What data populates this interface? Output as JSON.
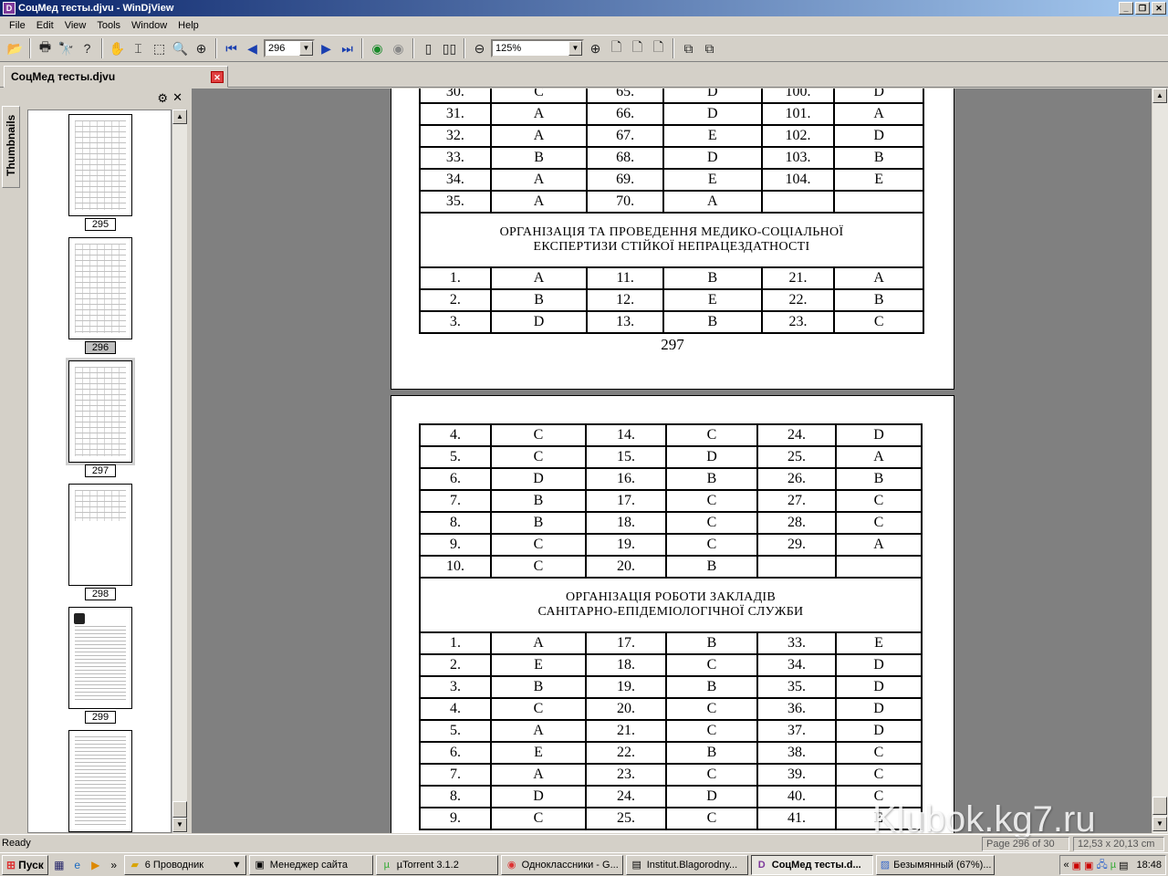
{
  "window": {
    "title": "СоцМед тесты.djvu - WinDjView"
  },
  "menu": [
    "File",
    "Edit",
    "View",
    "Tools",
    "Window",
    "Help"
  ],
  "toolbar": {
    "page_value": "296",
    "zoom_value": "125%"
  },
  "doc_tab": {
    "label": "СоцМед тесты.djvu"
  },
  "sidebar": {
    "tab_label": "Thumbnails",
    "thumbs": [
      {
        "label": "295"
      },
      {
        "label": "296"
      },
      {
        "label": "297"
      },
      {
        "label": "298"
      },
      {
        "label": "299"
      }
    ]
  },
  "page297": {
    "rows_top": [
      [
        "30.",
        "C",
        "65.",
        "D",
        "100.",
        "D"
      ],
      [
        "31.",
        "A",
        "66.",
        "D",
        "101.",
        "A"
      ],
      [
        "32.",
        "A",
        "67.",
        "E",
        "102.",
        "D"
      ],
      [
        "33.",
        "B",
        "68.",
        "D",
        "103.",
        "B"
      ],
      [
        "34.",
        "A",
        "69.",
        "E",
        "104.",
        "E"
      ],
      [
        "35.",
        "A",
        "70.",
        "A",
        "",
        ""
      ]
    ],
    "section_title": "ОРГАНІЗАЦІЯ ТА ПРОВЕДЕННЯ МЕДИКО-СОЦІАЛЬНОЇ ЕКСПЕРТИЗИ СТІЙКОЇ НЕПРАЦЕЗДАТНОСТІ",
    "rows_bottom": [
      [
        "1.",
        "A",
        "11.",
        "B",
        "21.",
        "A"
      ],
      [
        "2.",
        "B",
        "12.",
        "E",
        "22.",
        "B"
      ],
      [
        "3.",
        "D",
        "13.",
        "B",
        "23.",
        "C"
      ]
    ],
    "page_number": "297"
  },
  "page298": {
    "rows_top": [
      [
        "4.",
        "C",
        "14.",
        "C",
        "24.",
        "D"
      ],
      [
        "5.",
        "C",
        "15.",
        "D",
        "25.",
        "A"
      ],
      [
        "6.",
        "D",
        "16.",
        "B",
        "26.",
        "B"
      ],
      [
        "7.",
        "B",
        "17.",
        "C",
        "27.",
        "C"
      ],
      [
        "8.",
        "B",
        "18.",
        "C",
        "28.",
        "C"
      ],
      [
        "9.",
        "C",
        "19.",
        "C",
        "29.",
        "A"
      ],
      [
        "10.",
        "C",
        "20.",
        "B",
        "",
        ""
      ]
    ],
    "section_title_1": "ОРГАНІЗАЦІЯ РОБОТИ ЗАКЛАДІВ",
    "section_title_2": "САНІТАРНО-ЕПІДЕМІОЛОГІЧНОЇ СЛУЖБИ",
    "rows_bottom": [
      [
        "1.",
        "A",
        "17.",
        "B",
        "33.",
        "E"
      ],
      [
        "2.",
        "E",
        "18.",
        "C",
        "34.",
        "D"
      ],
      [
        "3.",
        "B",
        "19.",
        "B",
        "35.",
        "D"
      ],
      [
        "4.",
        "C",
        "20.",
        "C",
        "36.",
        "D"
      ],
      [
        "5.",
        "A",
        "21.",
        "C",
        "37.",
        "D"
      ],
      [
        "6.",
        "E",
        "22.",
        "B",
        "38.",
        "C"
      ],
      [
        "7.",
        "A",
        "23.",
        "C",
        "39.",
        "C"
      ],
      [
        "8.",
        "D",
        "24.",
        "D",
        "40.",
        "C"
      ],
      [
        "9.",
        "C",
        "25.",
        "C",
        "41.",
        "E"
      ]
    ]
  },
  "status": {
    "ready": "Ready",
    "page": "Page 296 of 30",
    "size": "12,53 x 20,13 cm",
    "watermark": "Klubok.kg7.ru"
  },
  "taskbar": {
    "start": "Пуск",
    "tasks": [
      {
        "label": "6 Проводник",
        "icon": "folder-icon"
      },
      {
        "label": "Менеджер сайта",
        "icon": "app-icon"
      },
      {
        "label": "µTorrent 3.1.2",
        "icon": "utorrent-icon"
      },
      {
        "label": "Одноклассники - G...",
        "icon": "chrome-icon"
      },
      {
        "label": "Institut.Blagorodny...",
        "icon": "app-icon"
      },
      {
        "label": "СоцМед тесты.d...",
        "icon": "djview-icon"
      },
      {
        "label": "Безымянный (67%)...",
        "icon": "paint-icon"
      }
    ],
    "clock": "18:48"
  }
}
